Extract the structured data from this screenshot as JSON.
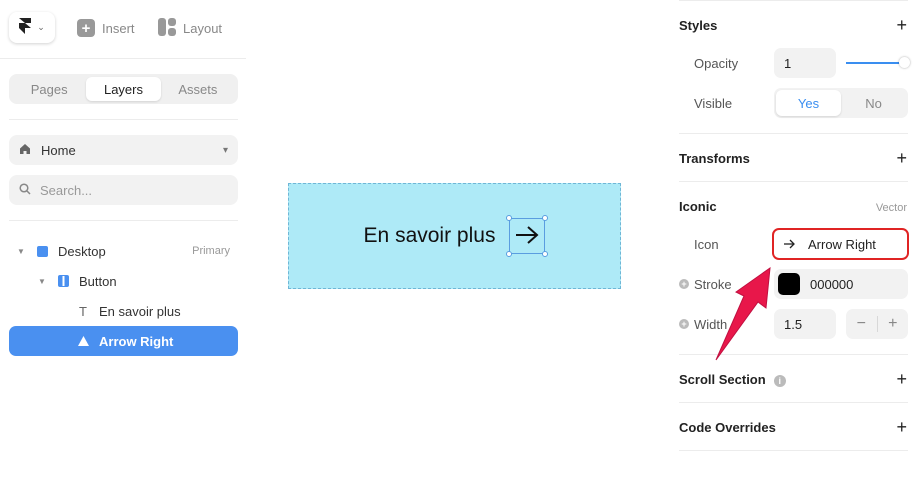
{
  "toolbar": {
    "insert_label": "Insert",
    "layout_label": "Layout"
  },
  "left_tabs": [
    {
      "label": "Pages",
      "active": false
    },
    {
      "label": "Layers",
      "active": true
    },
    {
      "label": "Assets",
      "active": false
    }
  ],
  "page_select": {
    "value": "Home"
  },
  "search": {
    "placeholder": "Search..."
  },
  "layers": [
    {
      "label": "Desktop",
      "badge": "Primary",
      "icon": "frame-icon"
    },
    {
      "label": "Button",
      "icon": "stack-icon"
    },
    {
      "label": "En savoir plus",
      "icon": "text-icon"
    },
    {
      "label": "Arrow Right",
      "icon": "component-icon",
      "selected": true
    }
  ],
  "canvas": {
    "button_text": "En savoir plus",
    "frame_color": "#aeeaf7"
  },
  "properties": {
    "styles": {
      "title": "Styles",
      "opacity_label": "Opacity",
      "opacity_value": "1",
      "visible_label": "Visible",
      "visible_yes": "Yes",
      "visible_no": "No"
    },
    "transforms": {
      "title": "Transforms"
    },
    "iconic": {
      "title": "Iconic",
      "hint": "Vector",
      "icon_label": "Icon",
      "icon_value": "Arrow Right",
      "stroke_label": "Stroke",
      "stroke_value": "000000",
      "stroke_color": "#000000",
      "width_label": "Width",
      "width_value": "1.5",
      "minus": "−",
      "plus": "+"
    },
    "scroll_section": {
      "title": "Scroll Section"
    },
    "code_overrides": {
      "title": "Code Overrides"
    }
  },
  "colors": {
    "accent": "#3a8ef0",
    "selected_layer": "#4a90f0",
    "highlight": "#e02424"
  }
}
